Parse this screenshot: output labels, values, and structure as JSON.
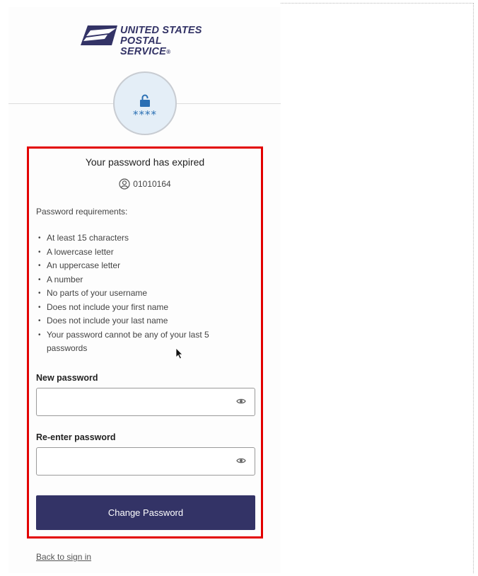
{
  "logo": {
    "line1": "UNITED STATES",
    "line2": "POSTAL SERVICE",
    "registered_mark": "®",
    "brand_color": "#333366"
  },
  "badge": {
    "icon": "unlock-icon",
    "masked_text": "****",
    "accent_color": "#2a6fb3"
  },
  "form": {
    "title": "Your password has expired",
    "username": "01010164",
    "user_icon": "user-circle-icon",
    "requirements_heading": "Password requirements:",
    "requirements": [
      "At least 15 characters",
      "A lowercase letter",
      "An uppercase letter",
      "A number",
      "No parts of your username",
      "Does not include your first name",
      "Does not include your last name",
      "Your password cannot be any of your last 5 passwords"
    ],
    "new_password": {
      "label": "New password",
      "value": "",
      "toggle_icon": "eye-icon"
    },
    "reenter_password": {
      "label": "Re-enter password",
      "value": "",
      "toggle_icon": "eye-icon"
    },
    "submit_label": "Change Password",
    "highlight_color": "#e30000"
  },
  "back_link": "Back to sign in"
}
